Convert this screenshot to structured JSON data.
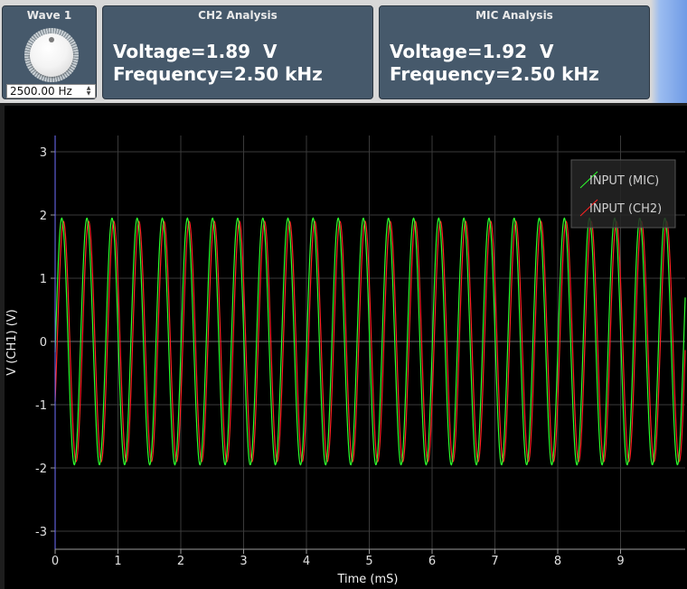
{
  "wave_panel": {
    "title": "Wave 1",
    "frequency_value": "2500.00 Hz"
  },
  "ch2_panel": {
    "title": "CH2 Analysis",
    "voltage": "Voltage=1.89  V",
    "frequency": "Frequency=2.50 kHz"
  },
  "mic_panel": {
    "title": "MIC Analysis",
    "voltage": "Voltage=1.92  V",
    "frequency": "Frequency=2.50 kHz"
  },
  "colors": {
    "mic": "#2dff2d",
    "ch2": "#ff2222",
    "panel": "#46596b",
    "plot_bg": "#000000"
  },
  "chart_data": {
    "type": "line",
    "xlabel": "Time (mS)",
    "ylabel": "V (CH1) (V)",
    "xlim": [
      0,
      10
    ],
    "ylim": [
      -3.3,
      3.3
    ],
    "x_ticks": [
      "0",
      "1",
      "2",
      "3",
      "4",
      "5",
      "6",
      "7",
      "8",
      "9"
    ],
    "y_ticks": [
      "3",
      "2",
      "1",
      "0",
      "-1",
      "-2",
      "-3"
    ],
    "grid": true,
    "legend_position": "top-right",
    "series": [
      {
        "name": "INPUT (MIC)",
        "color": "#2dff2d",
        "amplitude": 1.95,
        "frequency_khz": 2.5,
        "phase_deg": -5
      },
      {
        "name": "INPUT (CH2)",
        "color": "#ff2222",
        "amplitude": 1.9,
        "frequency_khz": 2.5,
        "phase_deg": -30
      }
    ]
  }
}
